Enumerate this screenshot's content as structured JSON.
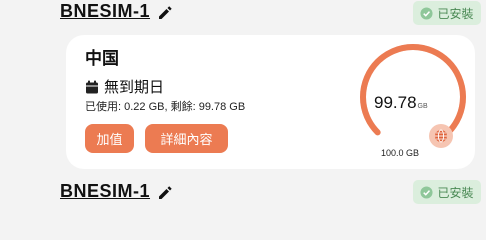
{
  "sims": [
    {
      "name": "BNESIM-1",
      "status": "已安裝"
    },
    {
      "name": "BNESIM-1",
      "status": "已安裝"
    }
  ],
  "plan": {
    "country": "中国",
    "expiry": "無到期日",
    "usage_text": "已使用: 0.22 GB, 剩餘: 99.78 GB",
    "topup_label": "加值",
    "detail_label": "詳細內容",
    "remaining_value": "99.78",
    "remaining_unit": "GB",
    "total": "100.0 GB",
    "remaining_fraction": 0.9978
  },
  "colors": {
    "accent": "#ec7b52",
    "badge_bg": "#dbeedd",
    "badge_text": "#4b8a55"
  }
}
